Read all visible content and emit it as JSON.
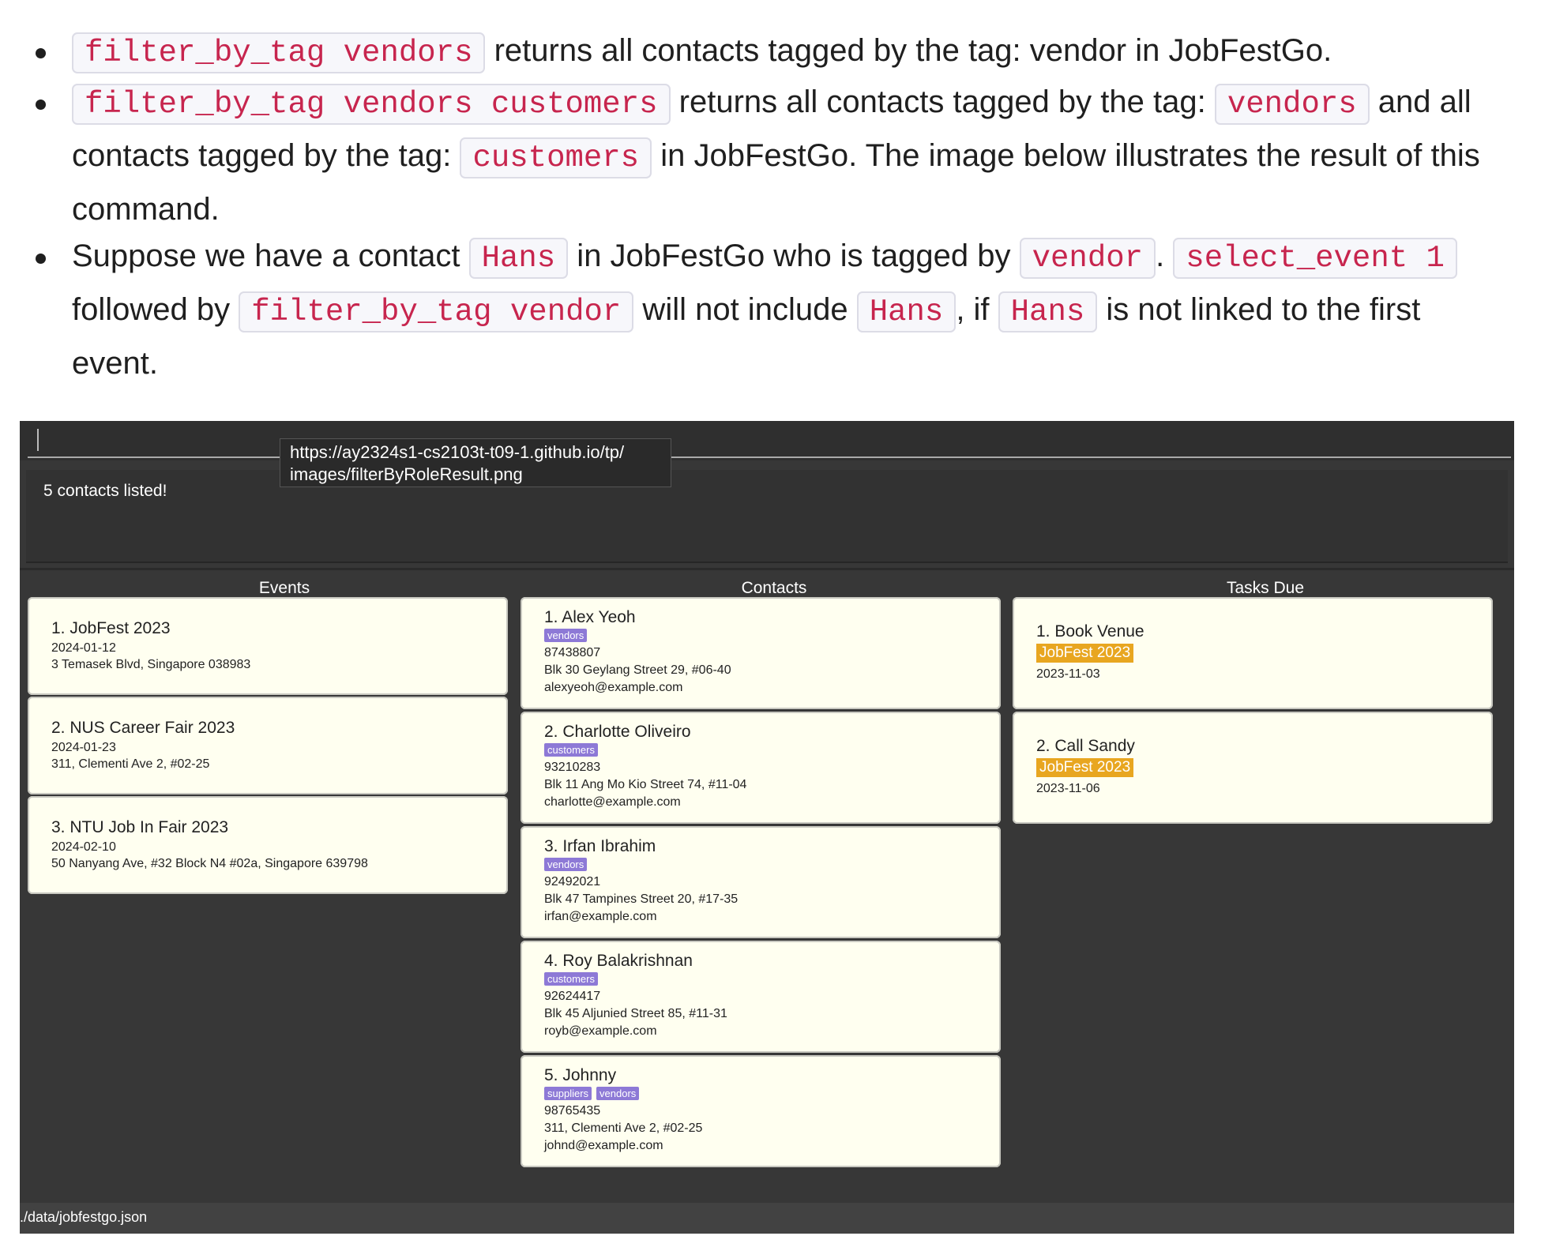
{
  "doc": {
    "b1": {
      "code1": "filter_by_tag vendors",
      "text1": " returns all contacts tagged by the tag: vendor in JobFestGo."
    },
    "b2": {
      "code1": "filter_by_tag vendors customers",
      "text1": " returns all contacts tagged by the tag: ",
      "code2": "vendors",
      "text2": " and all contacts tagged by the tag: ",
      "code3": "customers",
      "text3": " in JobFestGo. The image below illustrates the result of this command."
    },
    "b3": {
      "text1": "Suppose we have a contact ",
      "code1": "Hans",
      "text2": " in JobFestGo who is tagged by ",
      "code2": "vendor",
      "text3": ". ",
      "code3": "select_event 1",
      "text4": " followed by ",
      "code4": "filter_by_tag vendor",
      "text5": " will not include ",
      "code5": "Hans",
      "text6": ", if ",
      "code6": "Hans",
      "text7": " is not linked to the first event."
    }
  },
  "app": {
    "result_message": "5 contacts listed!",
    "tooltip_line1": "https://ay2324s1-cs2103t-t09-1.github.io/tp/",
    "tooltip_line2": "images/filterByRoleResult.png",
    "columns": {
      "events": "Events",
      "contacts": "Contacts",
      "tasks": "Tasks Due"
    },
    "events": [
      {
        "name": "1.  JobFest 2023",
        "date": "2024-01-12",
        "address": "3 Temasek Blvd, Singapore 038983"
      },
      {
        "name": "2.  NUS Career Fair 2023",
        "date": "2024-01-23",
        "address": "311, Clementi Ave 2, #02-25"
      },
      {
        "name": "3.  NTU Job In Fair 2023",
        "date": "2024-02-10",
        "address": "50 Nanyang Ave, #32 Block N4 #02a, Singapore 639798"
      }
    ],
    "contacts": [
      {
        "name": "1.  Alex Yeoh",
        "tags": [
          "vendors"
        ],
        "phone": "87438807",
        "address": "Blk 30 Geylang Street 29, #06-40",
        "email": "alexyeoh@example.com"
      },
      {
        "name": "2.  Charlotte Oliveiro",
        "tags": [
          "customers"
        ],
        "phone": "93210283",
        "address": "Blk 11 Ang Mo Kio Street 74, #11-04",
        "email": "charlotte@example.com"
      },
      {
        "name": "3.  Irfan Ibrahim",
        "tags": [
          "vendors"
        ],
        "phone": "92492021",
        "address": "Blk 47 Tampines Street 20, #17-35",
        "email": "irfan@example.com"
      },
      {
        "name": "4.  Roy Balakrishnan",
        "tags": [
          "customers"
        ],
        "phone": "92624417",
        "address": "Blk 45 Aljunied Street 85, #11-31",
        "email": "royb@example.com"
      },
      {
        "name": "5.  Johnny",
        "tags": [
          "suppliers",
          "vendors"
        ],
        "phone": "98765435",
        "address": "311, Clementi Ave 2, #02-25",
        "email": "johnd@example.com"
      }
    ],
    "tasks": [
      {
        "name": "1.  Book Venue",
        "event": "JobFest 2023",
        "date": "2023-11-03"
      },
      {
        "name": "2.  Call Sandy",
        "event": "JobFest 2023",
        "date": "2023-11-06"
      }
    ],
    "status_path": "./data/jobfestgo.json"
  }
}
